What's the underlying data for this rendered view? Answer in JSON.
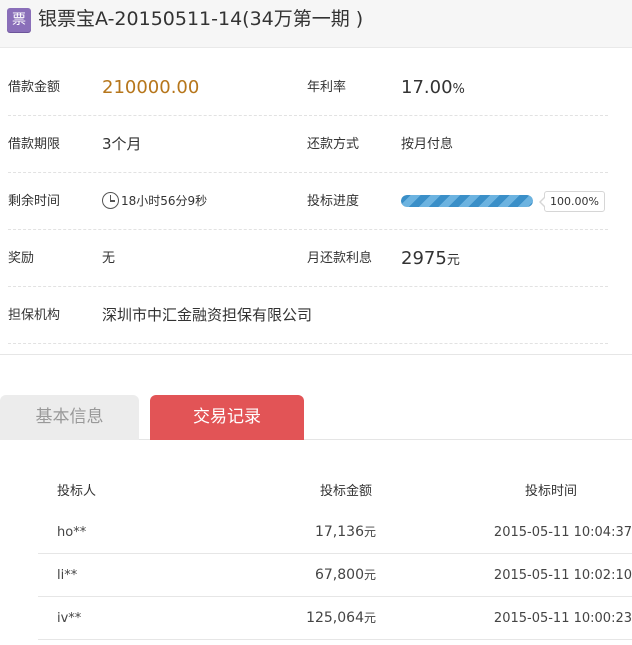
{
  "header": {
    "badge": "票",
    "title": "银票宝A-20150511-14(34万第一期 )"
  },
  "details": {
    "amount_label": "借款金额",
    "amount_value": "210000.00",
    "rate_label": "年利率",
    "rate_value": "17.00",
    "rate_unit": "%",
    "term_label": "借款期限",
    "term_value": "3个月",
    "repay_method_label": "还款方式",
    "repay_method_value": "按月付息",
    "remaining_label": "剩余时间",
    "remaining_value": "18小时56分9秒",
    "progress_label": "投标进度",
    "progress_percent": 100,
    "progress_text": "100.00%",
    "reward_label": "奖励",
    "reward_value": "无",
    "monthly_interest_label": "月还款利息",
    "monthly_interest_value": "2975",
    "monthly_interest_unit": "元",
    "guarantor_label": "担保机构",
    "guarantor_value": "深圳市中汇金融资担保有限公司"
  },
  "tabs": [
    {
      "label": "基本信息",
      "active": false
    },
    {
      "label": "交易记录",
      "active": true
    }
  ],
  "records": {
    "headers": [
      "投标人",
      "投标金额",
      "投标时间"
    ],
    "rows": [
      {
        "investor": "ho**",
        "amount": "17,136",
        "unit": "元",
        "time": "2015-05-11 10:04:37"
      },
      {
        "investor": "li**",
        "amount": "67,800",
        "unit": "元",
        "time": "2015-05-11 10:02:10"
      },
      {
        "investor": "iv**",
        "amount": "125,064",
        "unit": "元",
        "time": "2015-05-11 10:00:23"
      }
    ]
  },
  "colors": {
    "accent_tab": "#e25456",
    "amount_text": "#b6761b",
    "badge_bg": "#8a6fb9",
    "progress_bar": "#3a8fc8"
  },
  "icons": [
    "ticket-badge-icon",
    "clock-icon"
  ]
}
